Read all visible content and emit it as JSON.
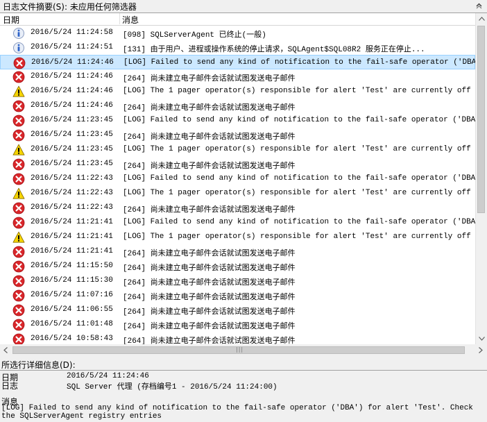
{
  "filter_bar": {
    "text": "日志文件摘要(S): 未应用任何筛选器"
  },
  "columns": {
    "date": "日期",
    "message": "消息"
  },
  "rows": [
    {
      "type": "info",
      "date": "2016/5/24 11:24:58",
      "message": "[098] SQLServerAgent 已终止(一般)"
    },
    {
      "type": "info",
      "date": "2016/5/24 11:24:51",
      "message": "[131] 由于用户、进程或操作系统的停止请求，SQLAgent$SQL08R2 服务正在停止..."
    },
    {
      "type": "error",
      "date": "2016/5/24 11:24:46",
      "message": "[LOG] Failed to send any kind of notification to the fail-safe operator ('DBA') for a",
      "selected": true
    },
    {
      "type": "error",
      "date": "2016/5/24 11:24:46",
      "message": "[264] 尚未建立电子邮件会话就试图发送电子邮件"
    },
    {
      "type": "warning",
      "date": "2016/5/24 11:24:46",
      "message": "[LOG] The 1 pager operator(s) responsible for alert 'Test' are currently off duty so"
    },
    {
      "type": "error",
      "date": "2016/5/24 11:24:46",
      "message": "[264] 尚未建立电子邮件会话就试图发送电子邮件"
    },
    {
      "type": "error",
      "date": "2016/5/24 11:23:45",
      "message": "[LOG] Failed to send any kind of notification to the fail-safe operator ('DBA') for a"
    },
    {
      "type": "error",
      "date": "2016/5/24 11:23:45",
      "message": "[264] 尚未建立电子邮件会话就试图发送电子邮件"
    },
    {
      "type": "warning",
      "date": "2016/5/24 11:23:45",
      "message": "[LOG] The 1 pager operator(s) responsible for alert 'Test' are currently off duty so"
    },
    {
      "type": "error",
      "date": "2016/5/24 11:23:45",
      "message": "[264] 尚未建立电子邮件会话就试图发送电子邮件"
    },
    {
      "type": "error",
      "date": "2016/5/24 11:22:43",
      "message": "[LOG] Failed to send any kind of notification to the fail-safe operator ('DBA') for a"
    },
    {
      "type": "warning",
      "date": "2016/5/24 11:22:43",
      "message": "[LOG] The 1 pager operator(s) responsible for alert 'Test' are currently off duty so"
    },
    {
      "type": "error",
      "date": "2016/5/24 11:22:43",
      "message": "[264] 尚未建立电子邮件会话就试图发送电子邮件"
    },
    {
      "type": "error",
      "date": "2016/5/24 11:21:41",
      "message": "[LOG] Failed to send any kind of notification to the fail-safe operator ('DBA') for a"
    },
    {
      "type": "warning",
      "date": "2016/5/24 11:21:41",
      "message": "[LOG] The 1 pager operator(s) responsible for alert 'Test' are currently off duty so"
    },
    {
      "type": "error",
      "date": "2016/5/24 11:21:41",
      "message": "[264] 尚未建立电子邮件会话就试图发送电子邮件"
    },
    {
      "type": "error",
      "date": "2016/5/24 11:15:50",
      "message": "[264] 尚未建立电子邮件会话就试图发送电子邮件"
    },
    {
      "type": "error",
      "date": "2016/5/24 11:15:30",
      "message": "[264] 尚未建立电子邮件会话就试图发送电子邮件"
    },
    {
      "type": "error",
      "date": "2016/5/24 11:07:16",
      "message": "[264] 尚未建立电子邮件会话就试图发送电子邮件"
    },
    {
      "type": "error",
      "date": "2016/5/24 11:06:55",
      "message": "[264] 尚未建立电子邮件会话就试图发送电子邮件"
    },
    {
      "type": "error",
      "date": "2016/5/24 11:01:48",
      "message": "[264] 尚未建立电子邮件会话就试图发送电子邮件"
    },
    {
      "type": "error",
      "date": "2016/5/24 10:58:43",
      "message": "[264] 尚未建立电子邮件会话就试图发送电子邮件"
    }
  ],
  "detail": {
    "title": "所选行详细信息(D):",
    "date_label": "日期",
    "date_value": "2016/5/24 11:24:46",
    "log_label": "日志",
    "log_value": "SQL Server 代理 (存档编号1 - 2016/5/24 11:24:00)",
    "message_label": "消息",
    "message_value": "[LOG] Failed to send any kind of notification to the fail-safe operator ('DBA') for alert 'Test'.  Check the SQLServerAgent registry entries"
  },
  "icons": {
    "info": "info-icon",
    "error": "error-icon",
    "warning": "warning-icon",
    "collapse": "collapse-icon"
  },
  "colors": {
    "selection": "#cce8ff",
    "error": "#d9262a",
    "warning": "#f5d400",
    "info": "#2c62c8"
  }
}
